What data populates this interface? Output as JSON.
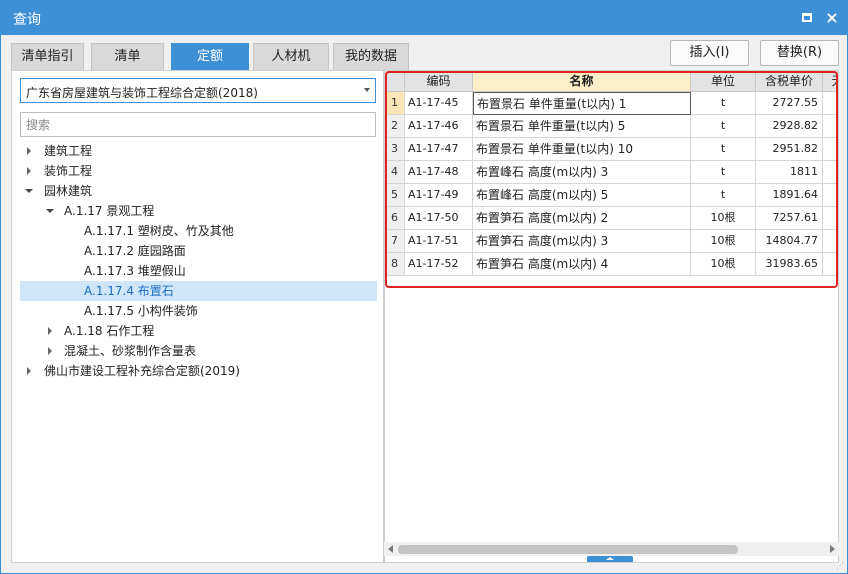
{
  "window": {
    "title": "查询",
    "maximize_icon": "maximize-icon",
    "close_icon": "close-icon",
    "close_glyph": "×"
  },
  "tabs": [
    {
      "label": "清单指引",
      "active": false
    },
    {
      "label": "清单",
      "active": false
    },
    {
      "label": "定额",
      "active": true
    },
    {
      "label": "人材机",
      "active": false
    },
    {
      "label": "我的数据",
      "active": false
    }
  ],
  "buttons": {
    "insert": "插入(I)",
    "replace": "替换(R)"
  },
  "quota_library": {
    "selected": "广东省房屋建筑与装饰工程综合定额(2018)"
  },
  "search": {
    "placeholder": "搜索",
    "value": ""
  },
  "tree": [
    {
      "label": "建筑工程",
      "level": 0,
      "state": "collapsed"
    },
    {
      "label": "装饰工程",
      "level": 0,
      "state": "collapsed"
    },
    {
      "label": "园林建筑",
      "level": 0,
      "state": "expanded"
    },
    {
      "label": "A.1.17 景观工程",
      "level": 1,
      "state": "expanded"
    },
    {
      "label": "A.1.17.1 塑树皮、竹及其他",
      "level": 2,
      "state": "leaf"
    },
    {
      "label": "A.1.17.2 庭园路面",
      "level": 2,
      "state": "leaf"
    },
    {
      "label": "A.1.17.3 堆塑假山",
      "level": 2,
      "state": "leaf"
    },
    {
      "label": "A.1.17.4 布置石",
      "level": 2,
      "state": "leaf",
      "selected": true
    },
    {
      "label": "A.1.17.5 小构件装饰",
      "level": 2,
      "state": "leaf"
    },
    {
      "label": "A.1.18 石作工程",
      "level": 1,
      "state": "collapsed"
    },
    {
      "label": "混凝土、砂浆制作含量表",
      "level": 1,
      "state": "collapsed"
    },
    {
      "label": "佛山市建设工程补充综合定额(2019)",
      "level": 0,
      "state": "collapsed"
    }
  ],
  "table": {
    "columns": [
      "编码",
      "名称",
      "单位",
      "含税单价",
      "无"
    ],
    "rows": [
      {
        "num": "1",
        "code": "A1-17-45",
        "name": "布置景石 单件重量(t以内) 1",
        "unit": "t",
        "price": "2727.55"
      },
      {
        "num": "2",
        "code": "A1-17-46",
        "name": "布置景石 单件重量(t以内) 5",
        "unit": "t",
        "price": "2928.82"
      },
      {
        "num": "3",
        "code": "A1-17-47",
        "name": "布置景石 单件重量(t以内) 10",
        "unit": "t",
        "price": "2951.82"
      },
      {
        "num": "4",
        "code": "A1-17-48",
        "name": "布置峰石 高度(m以内) 3",
        "unit": "t",
        "price": "1811"
      },
      {
        "num": "5",
        "code": "A1-17-49",
        "name": "布置峰石 高度(m以内) 5",
        "unit": "t",
        "price": "1891.64"
      },
      {
        "num": "6",
        "code": "A1-17-50",
        "name": "布置笋石 高度(m以内) 2",
        "unit": "10根",
        "price": "7257.61"
      },
      {
        "num": "7",
        "code": "A1-17-51",
        "name": "布置笋石 高度(m以内) 3",
        "unit": "10根",
        "price": "14804.77"
      },
      {
        "num": "8",
        "code": "A1-17-52",
        "name": "布置笋石 高度(m以内) 4",
        "unit": "10根",
        "price": "31983.65"
      }
    ],
    "current_row": 1
  },
  "colors": {
    "accent": "#3d8fd6",
    "highlight": "#e02222",
    "selection": "#cfe5f8",
    "header_name": "#fdf0c8"
  }
}
